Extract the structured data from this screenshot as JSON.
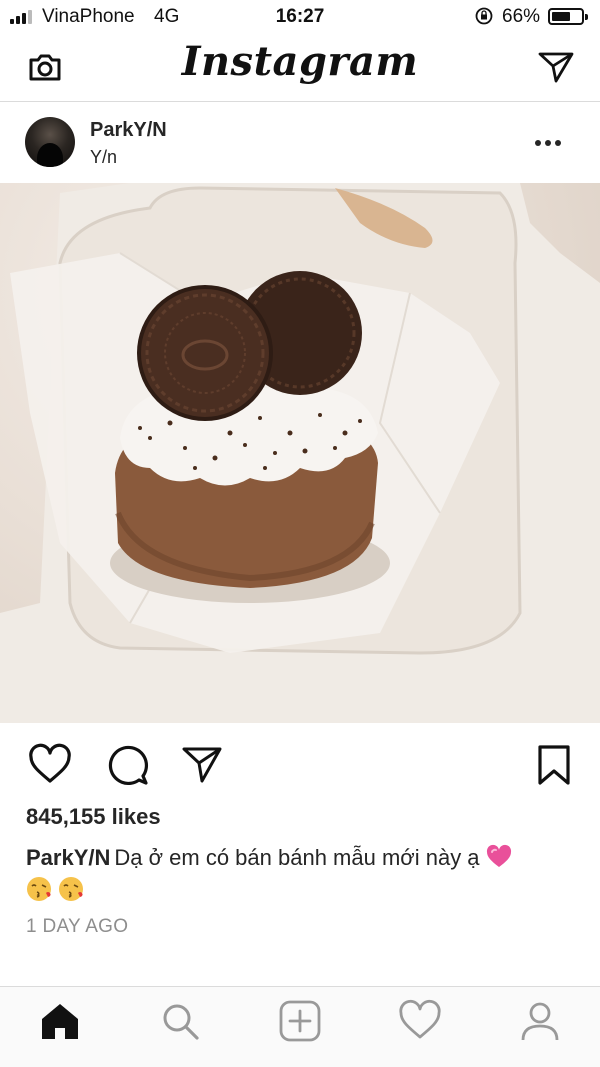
{
  "status_bar": {
    "carrier": "VinaPhone",
    "network": "4G",
    "time": "16:27",
    "battery_percent": "66%",
    "battery_level": 0.66
  },
  "header": {
    "logo": "Instagram",
    "camera_icon": "camera-icon",
    "direct_icon": "paper-plane-icon"
  },
  "post": {
    "username": "ParkY/N",
    "location": "Y/n",
    "more_icon": "more-horizontal-icon",
    "image_subject": "oreo-chocolate-cake-photo",
    "likes": "845,155 likes",
    "caption_user": "ParkY/N",
    "caption_text": "Dạ ở em có bán bánh mẫu mới này ạ",
    "caption_emojis": [
      "pink-heart",
      "kissing-face",
      "kissing-face"
    ],
    "time_ago": "1 DAY AGO"
  },
  "actions": {
    "like_icon": "heart-icon",
    "comment_icon": "comment-icon",
    "share_icon": "paper-plane-icon",
    "save_icon": "bookmark-icon"
  },
  "tab_bar": {
    "items": [
      "home",
      "search",
      "add",
      "activity",
      "profile"
    ]
  },
  "colors": {
    "text": "#262626",
    "muted": "#8e8e8e",
    "divider": "#dbdbdb",
    "heart_emoji": "#e9509a"
  }
}
